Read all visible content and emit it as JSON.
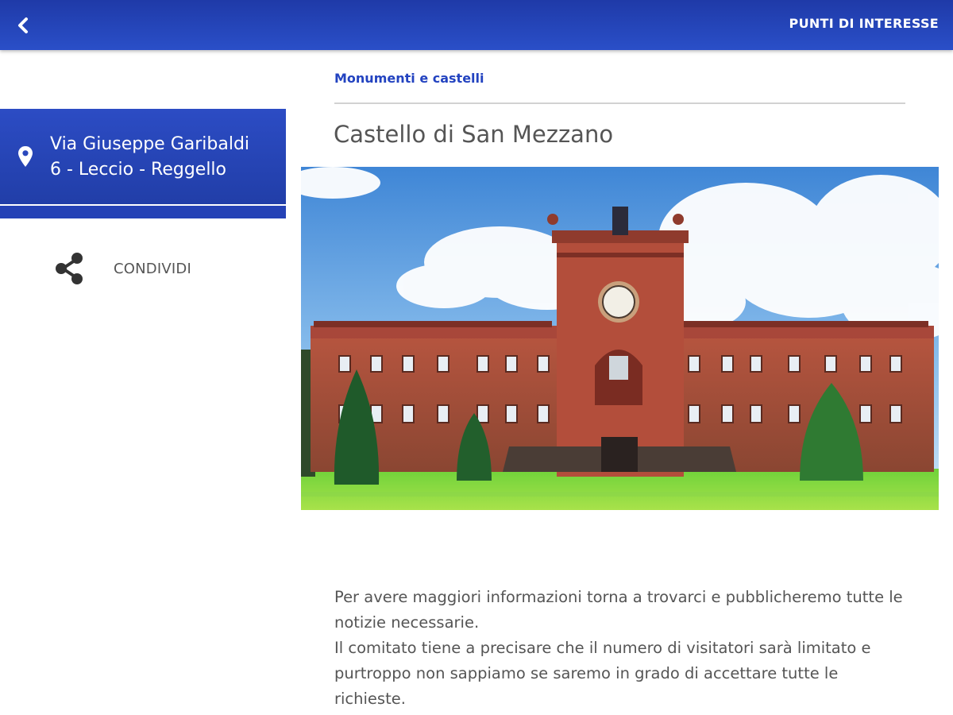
{
  "header": {
    "back_icon": "chevron-left-icon",
    "title": "PUNTI DI INTERESSE"
  },
  "sidebar": {
    "address_icon": "map-pin-icon",
    "address_line1": "Via Giuseppe Garibaldi",
    "address_line2": "6 - Leccio - Reggello",
    "share_icon": "share-icon",
    "share_label": "CONDIVIDI"
  },
  "main": {
    "category": "Monumenti e castelli",
    "title": "Castello di San Mezzano",
    "image_alt": "Castello di San Mezzano",
    "description": [
      "Per avere maggiori informazioni torna a trovarci e pubblicheremo tutte le notizie necessarie.",
      "Il comitato tiene a precisare che il numero di visitatori sarà limitato e purtroppo non sappiamo se saremo in grado di accettare tutte le richieste."
    ]
  },
  "colors": {
    "header_blue": "#2443b8",
    "accent_blue": "#2343c0",
    "text_gray": "#555555"
  }
}
